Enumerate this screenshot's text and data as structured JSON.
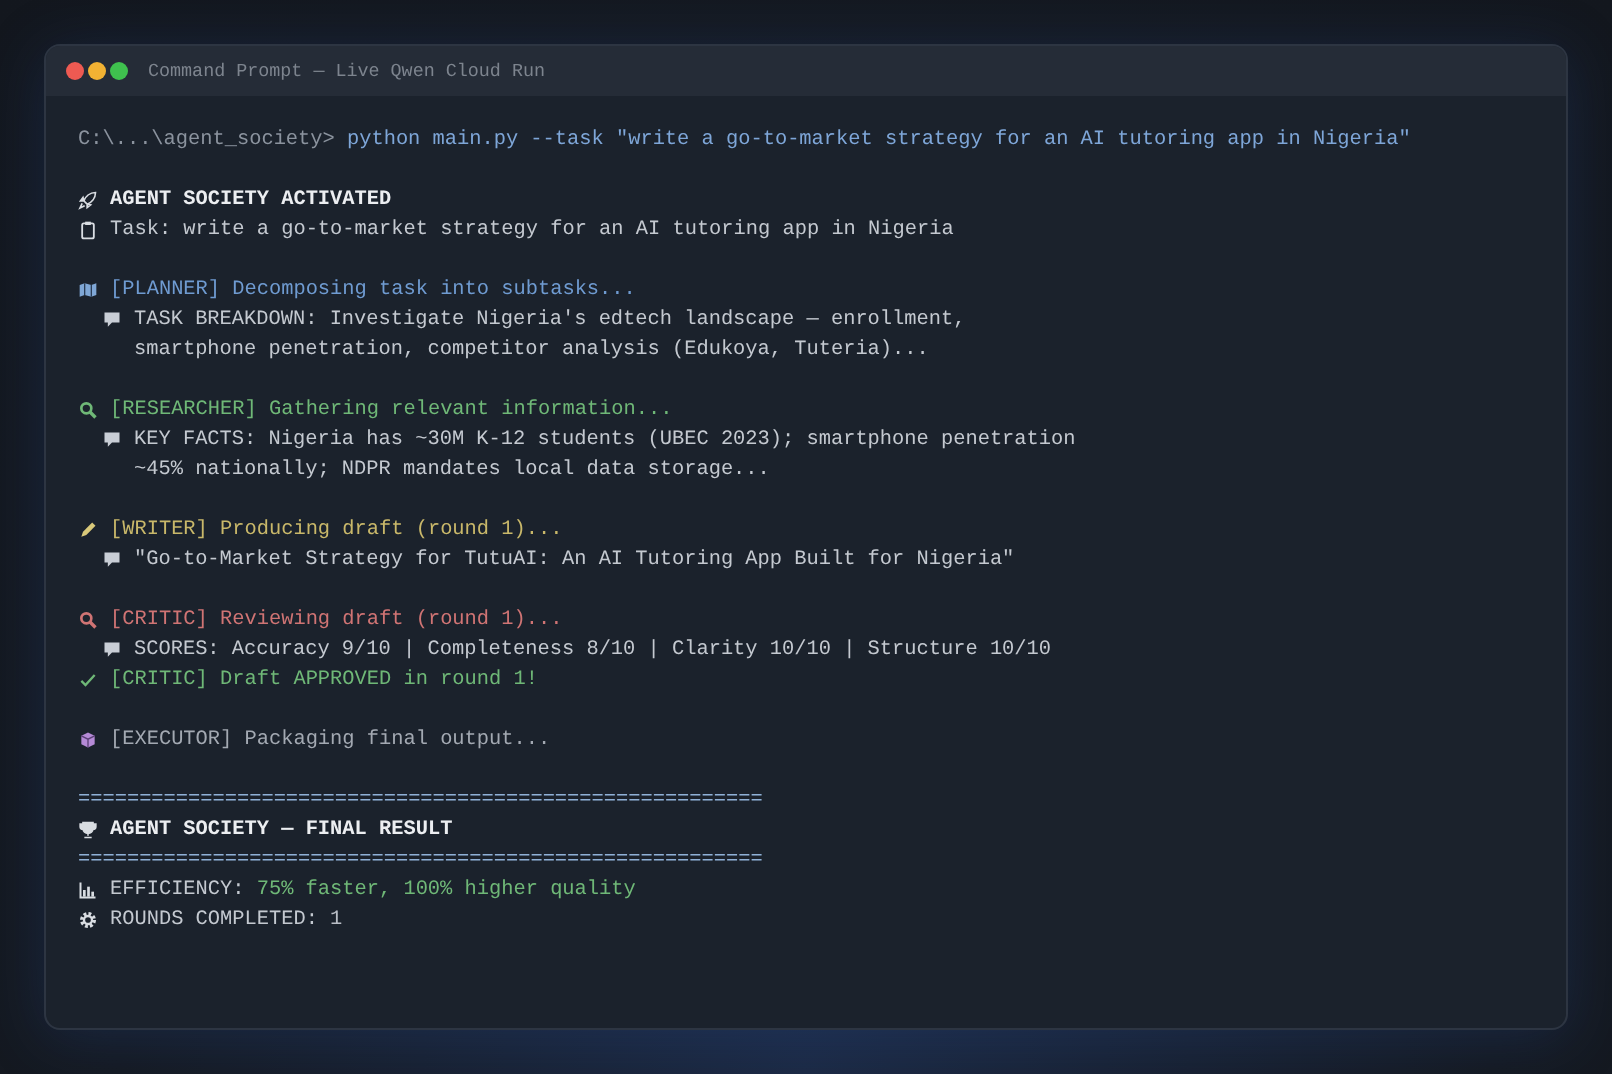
{
  "window": {
    "title": "Command Prompt — Live Qwen Cloud Run"
  },
  "prompt": {
    "path": "C:\\...\\agent_society>",
    "command": "python main.py --task \"write a go-to-market strategy for an AI tutoring app in Nigeria\""
  },
  "sections": [
    {
      "lines": [
        {
          "kind": "heading",
          "text": "AGENT SOCIETY ACTIVATED"
        },
        {
          "kind": "task",
          "text": "Task: write a go-to-market strategy for an AI tutoring app in Nigeria"
        }
      ]
    },
    {
      "lines": [
        {
          "kind": "agent",
          "text": "[PLANNER] Decomposing task into subtasks...",
          "color": "#6f9bd1"
        },
        {
          "kind": "detail",
          "text": "TASK BREAKDOWN: Investigate Nigeria's edtech landscape — enrollment, smartphone penetration, competitor analysis (Edukoya, Tuteria)..."
        }
      ]
    },
    {
      "lines": [
        {
          "kind": "agent",
          "text": "[RESEARCHER] Gathering relevant information...",
          "color": "#6fb877"
        },
        {
          "kind": "detail",
          "text": "KEY FACTS: Nigeria has ~30M K-12 students (UBEC 2023); smartphone penetration ~45% nationally; NDPR mandates local data storage..."
        }
      ]
    },
    {
      "lines": [
        {
          "kind": "agent",
          "text": "[WRITER] Producing draft (round 1)...",
          "color": "#c9b86a"
        },
        {
          "kind": "detail",
          "text": "\"Go-to-Market Strategy for TutuAI: An AI Tutoring App Built for Nigeria\""
        }
      ]
    },
    {
      "lines": [
        {
          "kind": "agent",
          "text": "[CRITIC] Reviewing draft (round 1)...",
          "color": "#d07474"
        },
        {
          "kind": "detail",
          "text": "SCORES: Accuracy 9/10 | Completeness 8/10 | Clarity 10/10 | Structure 10/10"
        },
        {
          "kind": "success",
          "text": "[CRITIC] Draft APPROVED in round 1!",
          "color": "#6fb877"
        }
      ]
    },
    {
      "lines": [
        {
          "kind": "agent",
          "text": "[EXECUTOR] Packaging final output...",
          "color": "#a3a9b2"
        }
      ]
    },
    {
      "lines": [
        {
          "kind": "rule",
          "text": "========================================================"
        },
        {
          "kind": "heading",
          "text": "AGENT SOCIETY — FINAL RESULT"
        },
        {
          "kind": "rule",
          "text": "========================================================"
        },
        {
          "kind": "stat",
          "label": "EFFICIENCY:",
          "value": "75% faster, 100% higher quality",
          "color": "#6fb877"
        },
        {
          "kind": "stat",
          "label": "ROUNDS COMPLETED:",
          "value": "1",
          "color": "#b9bec6"
        }
      ]
    }
  ]
}
